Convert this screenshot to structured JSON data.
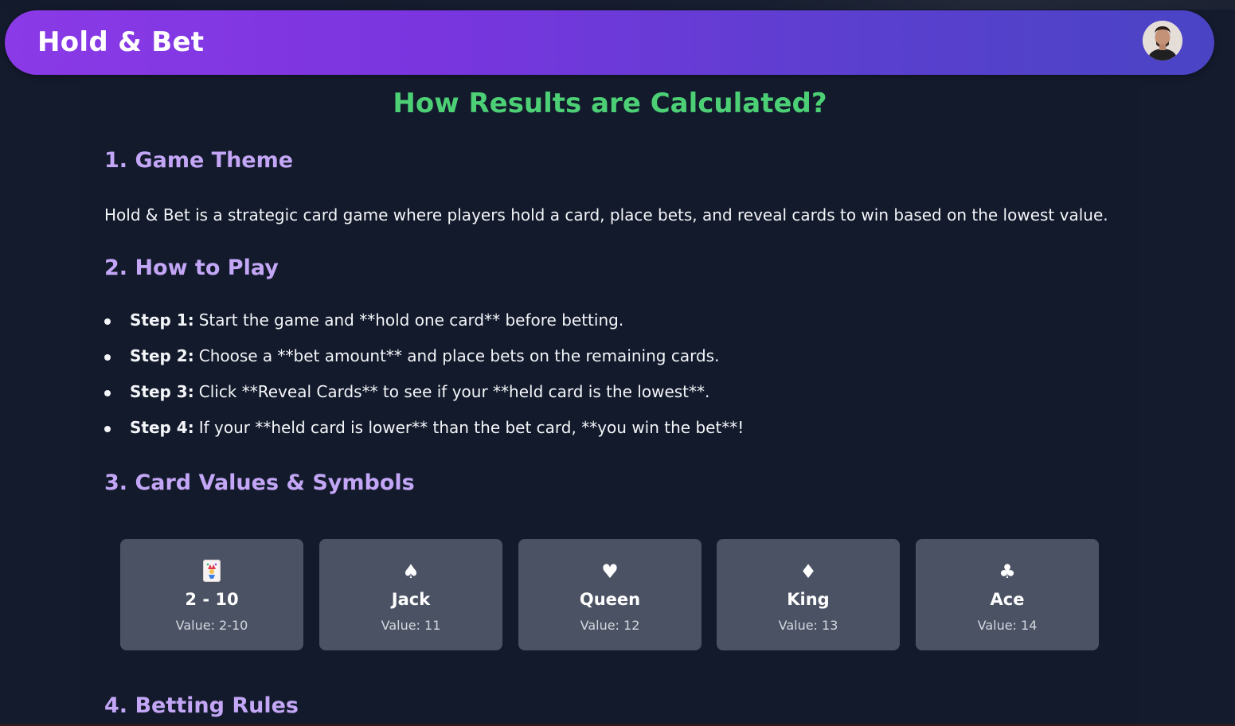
{
  "app": {
    "brand": "Hold & Bet"
  },
  "page": {
    "title": "How Results are Calculated?"
  },
  "sections": {
    "theme": {
      "heading": "1. Game Theme",
      "text": "Hold & Bet is a strategic card game where players hold a card, place bets, and reveal cards to win based on the lowest value."
    },
    "how_to_play": {
      "heading": "2. How to Play",
      "steps": [
        {
          "label": "Step 1:",
          "text": "Start the game and **hold one card** before betting."
        },
        {
          "label": "Step 2:",
          "text": "Choose a **bet amount** and place bets on the remaining cards."
        },
        {
          "label": "Step 3:",
          "text": "Click **Reveal Cards** to see if your **held card is the lowest**."
        },
        {
          "label": "Step 4:",
          "text": "If your **held card is lower** than the bet card, **you win the bet**!"
        }
      ]
    },
    "card_values": {
      "heading": "3. Card Values & Symbols",
      "cards": [
        {
          "icon": "joker-card-icon",
          "symbol": "",
          "name": "2 - 10",
          "value": "Value: 2-10"
        },
        {
          "icon": "spade-icon",
          "symbol": "♠",
          "name": "Jack",
          "value": "Value: 11"
        },
        {
          "icon": "heart-icon",
          "symbol": "♥",
          "name": "Queen",
          "value": "Value: 12"
        },
        {
          "icon": "diamond-icon",
          "symbol": "♦",
          "name": "King",
          "value": "Value: 13"
        },
        {
          "icon": "club-icon",
          "symbol": "♣",
          "name": "Ace",
          "value": "Value: 14"
        }
      ]
    },
    "betting_rules": {
      "heading": "4. Betting Rules"
    }
  },
  "colors": {
    "background": "#141b2d",
    "title_green": "#4ccf75",
    "heading_purple": "#c3a6f5",
    "card_bg": "#4b5264",
    "nav_gradient_start": "#8a3ae6",
    "nav_gradient_end": "#4a44c5"
  }
}
